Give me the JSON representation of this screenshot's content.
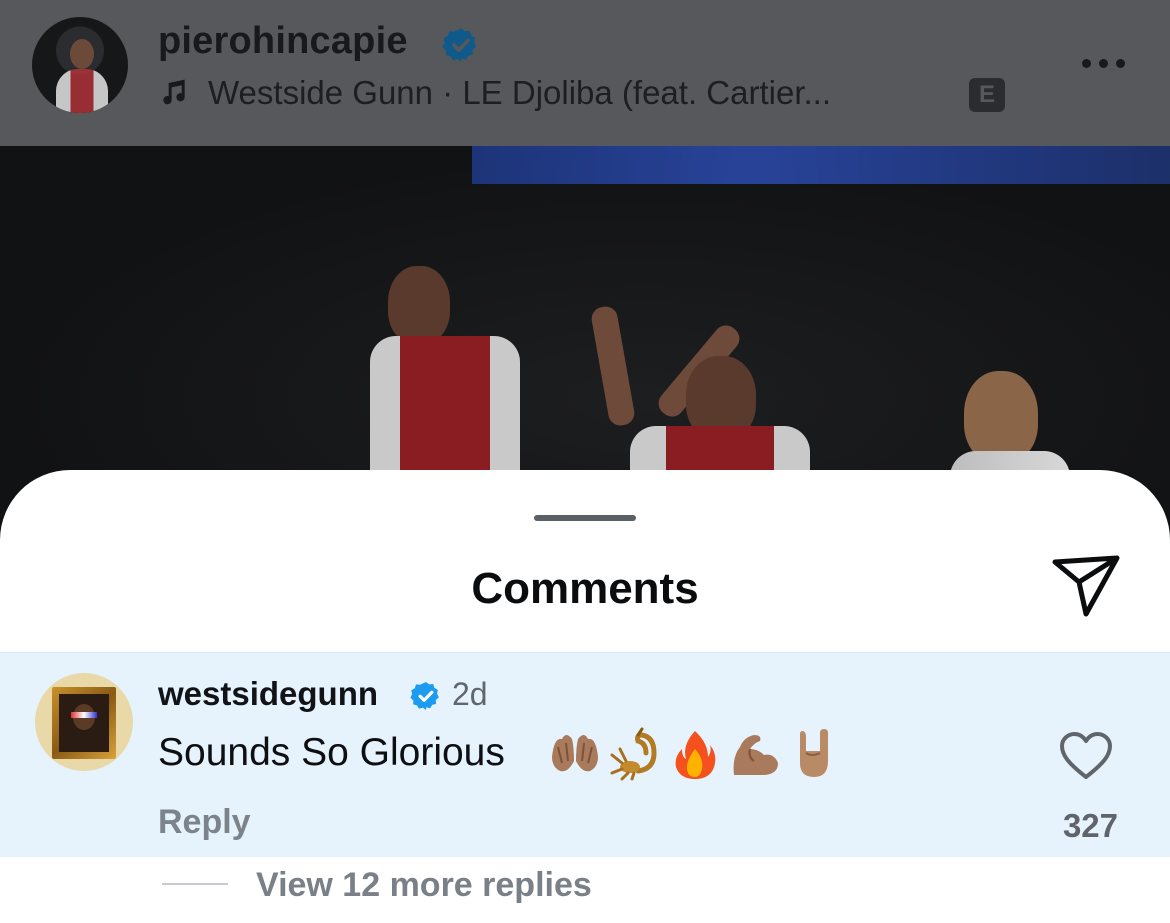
{
  "post_header": {
    "username": "pierohincapie",
    "song": "Westside Gunn · LE Djoliba (feat. Cartier...",
    "explicit_label": "E",
    "more_icon": "ellipsis-icon"
  },
  "comments_sheet": {
    "title": "Comments",
    "share_icon": "paper-plane-icon"
  },
  "comment": {
    "username": "westsidegunn",
    "time": "2d",
    "text": "Sounds So Glorious",
    "emojis": [
      "palms-up-together",
      "scorpion",
      "fire",
      "flexed-biceps",
      "sign-of-the-horns"
    ],
    "reply_label": "Reply",
    "like_count": "327"
  },
  "view_replies": "View 12 more replies",
  "colors": {
    "verified": "#1d9bf0",
    "comment_highlight": "#e6f3fd",
    "overlay_header": "#56585b"
  }
}
